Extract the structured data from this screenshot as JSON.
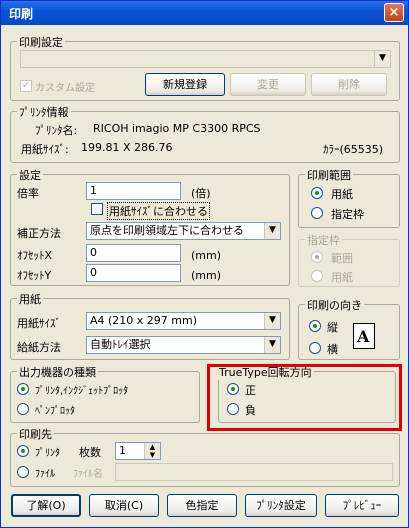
{
  "window": {
    "title": "印刷",
    "close": "×"
  },
  "print_settings": {
    "label": "印刷設定",
    "custom_check_label": "カスタム設定",
    "buttons": {
      "register": "新規登録",
      "change": "変更",
      "delete": "削除"
    }
  },
  "printer_info": {
    "label": "ﾌﾟﾘﾝﾀ情報",
    "name_label": "ﾌﾟﾘﾝﾀ名:",
    "name": "RICOH imagio MP C3300 RPCS",
    "paper_label": "用紙ｻｲｽﾞ:",
    "paper": "199.81 X 286.76",
    "color": "ｶﾗｰ(65535)"
  },
  "settings": {
    "label": "設定",
    "scale_label": "倍率",
    "scale_value": "1",
    "scale_unit": "(倍)",
    "fit_label": "用紙ｻｲｽﾞに合わせる",
    "correction_label": "補正方法",
    "correction_value": "原点を印刷領域左下に合わせる",
    "offset_x_label": "ｵﾌｾｯﾄX",
    "offset_x_value": "0",
    "offset_y_label": "ｵﾌｾｯﾄY",
    "offset_y_value": "0",
    "unit_mm": "(mm)"
  },
  "print_range": {
    "label": "印刷範囲",
    "paper": "用紙",
    "frame": "指定枠"
  },
  "frame": {
    "label": "指定枠",
    "range": "範囲",
    "paper": "用紙"
  },
  "paper": {
    "label": "用紙",
    "size_label": "用紙ｻｲｽﾞ",
    "size_value": "A4 (210 x 297 mm)",
    "feed_label": "給紙方法",
    "feed_value": "自動ﾄﾚｲ選択"
  },
  "orientation": {
    "label": "印刷の向き",
    "portrait": "縦",
    "landscape": "横",
    "icon_letter": "A"
  },
  "output_device": {
    "label": "出力機器の種類",
    "inkjet": "ﾌﾟﾘﾝﾀ,ｲﾝｸｼﾞｪｯﾄﾌﾟﾛｯﾀ",
    "pen": "ﾍﾟﾝﾌﾟﾛｯﾀ"
  },
  "truetype": {
    "label": "TrueType回転方向",
    "positive": "正",
    "negative": "負"
  },
  "destination": {
    "label": "印刷先",
    "printer": "ﾌﾟﾘﾝﾀ",
    "copies_label": "枚数",
    "copies_value": "1",
    "file": "ﾌｧｲﾙ",
    "filename_label": "ﾌｧｲﾙ名"
  },
  "footer": {
    "ok": "了解(O)",
    "cancel": "取消(C)",
    "color": "色指定",
    "printer_settings": "ﾌﾟﾘﾝﾀ設定",
    "preview": "ﾌﾟﾚﾋﾞｭｰ"
  },
  "colors": {
    "title_bar": "#0a54d8",
    "dialog_bg": "#ece9d8",
    "highlight": "#e00000"
  }
}
